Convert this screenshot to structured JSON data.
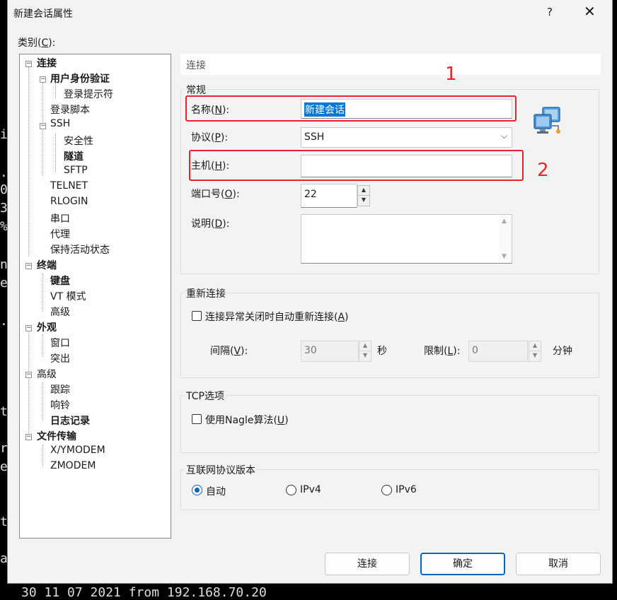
{
  "background_terminal": {
    "left_chars": [
      "i",
      ".",
      "0",
      "3",
      "%",
      "n",
      "e",
      ".",
      "t",
      "r",
      "e",
      "t",
      "a"
    ],
    "bottom_line": "30 11 07 2021 from 192.168.70.20"
  },
  "window": {
    "title": "新建会话属性",
    "help_label": "?",
    "close_label": "✕"
  },
  "category": {
    "label_prefix": "类别(",
    "label_key": "C",
    "label_suffix": "):"
  },
  "tree": [
    {
      "label": "连接",
      "bold": true
    },
    {
      "label": "用户身份验证",
      "bold": true
    },
    {
      "label": "登录提示符",
      "bold": false
    },
    {
      "label": "登录脚本",
      "bold": false
    },
    {
      "label": "SSH",
      "bold": false
    },
    {
      "label": "安全性",
      "bold": false
    },
    {
      "label": "隧道",
      "bold": true
    },
    {
      "label": "SFTP",
      "bold": false
    },
    {
      "label": "TELNET",
      "bold": false
    },
    {
      "label": "RLOGIN",
      "bold": false
    },
    {
      "label": "串口",
      "bold": false
    },
    {
      "label": "代理",
      "bold": false
    },
    {
      "label": "保持活动状态",
      "bold": false
    },
    {
      "label": "终端",
      "bold": true
    },
    {
      "label": "键盘",
      "bold": true
    },
    {
      "label": "VT 模式",
      "bold": false
    },
    {
      "label": "高级",
      "bold": false
    },
    {
      "label": "外观",
      "bold": true
    },
    {
      "label": "窗口",
      "bold": false
    },
    {
      "label": "突出",
      "bold": false
    },
    {
      "label": "高级",
      "bold": false
    },
    {
      "label": "跟踪",
      "bold": false
    },
    {
      "label": "响铃",
      "bold": false
    },
    {
      "label": "日志记录",
      "bold": true
    },
    {
      "label": "文件传输",
      "bold": true
    },
    {
      "label": "X/YMODEM",
      "bold": false
    },
    {
      "label": "ZMODEM",
      "bold": false
    }
  ],
  "panel_header": "连接",
  "general": {
    "title": "常规",
    "name_label_pre": "名称(",
    "name_key": "N",
    "name_label_post": "):",
    "name_value": "新建会话",
    "protocol_label_pre": "协议(",
    "protocol_key": "P",
    "protocol_label_post": "):",
    "protocol_value": "SSH",
    "host_label_pre": "主机(",
    "host_key": "H",
    "host_label_post": "):",
    "host_value": "",
    "port_label_pre": "端口号(",
    "port_key": "O",
    "port_label_post": "):",
    "port_value": "22",
    "desc_label_pre": "说明(",
    "desc_key": "D",
    "desc_label_post": "):",
    "desc_value": ""
  },
  "annotations": {
    "one": "1",
    "two": "2",
    "color": "#e8242a"
  },
  "reconnect": {
    "title": "重新连接",
    "checkbox_pre": "连接异常关闭时自动重新连接(",
    "checkbox_key": "A",
    "checkbox_post": ")",
    "interval_pre": "间隔(",
    "interval_key": "V",
    "interval_post": "):",
    "interval_value": "30",
    "interval_unit": "秒",
    "limit_pre": "限制(",
    "limit_key": "L",
    "limit_post": "):",
    "limit_value": "0",
    "limit_unit": "分钟"
  },
  "tcp": {
    "title": "TCP选项",
    "nagle_pre": "使用Nagle算法(",
    "nagle_key": "U",
    "nagle_post": ")"
  },
  "ipver": {
    "title": "互联网协议版本",
    "options": [
      "自动",
      "IPv4",
      "IPv6"
    ],
    "selected": "自动"
  },
  "buttons": {
    "connect": "连接",
    "ok": "确定",
    "cancel": "取消"
  },
  "colors": {
    "accent": "#0078d7",
    "annotation_red": "#e8242a"
  }
}
